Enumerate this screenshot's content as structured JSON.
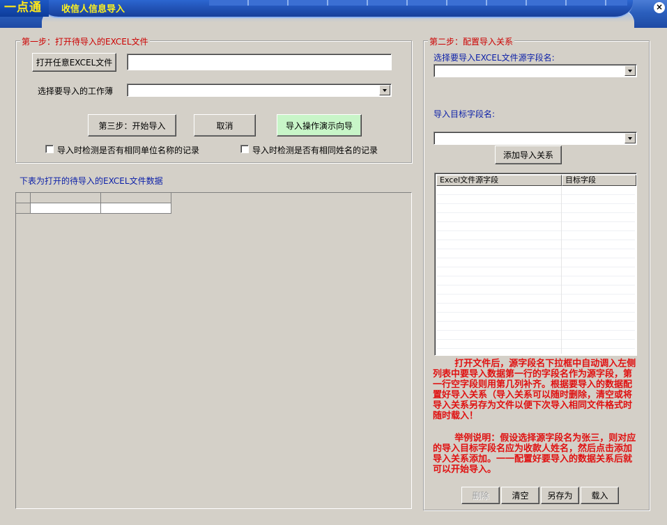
{
  "window": {
    "logo_text": "一点通",
    "title": "收信人信息导入",
    "close_glyph": "×"
  },
  "step1": {
    "legend": "第一步：打开待导入的EXCEL文件",
    "open_button": "打开任意EXCEL文件",
    "file_path": "",
    "sheet_label": "选择要导入的工作薄",
    "sheet_value": "",
    "start_button": "第三步：开始导入",
    "cancel_button": "取消",
    "guide_button": "导入操作演示向导",
    "check_company": "导入时检测是否有相同单位名称的记录",
    "check_name": "导入时检测是否有相同姓名的记录"
  },
  "grid": {
    "caption": "下表为打开的待导入的EXCEL文件数据"
  },
  "step2": {
    "legend": "第二步：配置导入关系",
    "source_label": "选择要导入EXCEL文件源字段名:",
    "source_value": "",
    "target_label": "导入目标字段名:",
    "target_value": "",
    "add_button": "添加导入关系",
    "columns": [
      "Excel文件源字段",
      "目标字段"
    ],
    "note1": "打开文件后，源字段名下拉框中自动调入左侧列表中要导入数据第一行的字段名作为源字段，第一行空字段则用第几列补齐。根据要导入的数据配置好导入关系（导入关系可以随时删除，清空或将导入关系另存为文件以便下次导入相同文件格式时随时载入！",
    "note2": "举例说明：假设选择源字段名为张三，则对应的导入目标字段名应为收款人姓名，然后点击添加导入关系添加。一一配置好要导入的数据关系后就可以开始导入。",
    "delete_button": "删除",
    "clear_button": "清空",
    "saveas_button": "另存为",
    "load_button": "载入"
  },
  "colors": {
    "title_text": "#fff31e",
    "legend_red": "#cc0000",
    "label_blue": "#0a1ea8",
    "note_red": "#e01010",
    "guide_green": "#c8f5c8"
  }
}
